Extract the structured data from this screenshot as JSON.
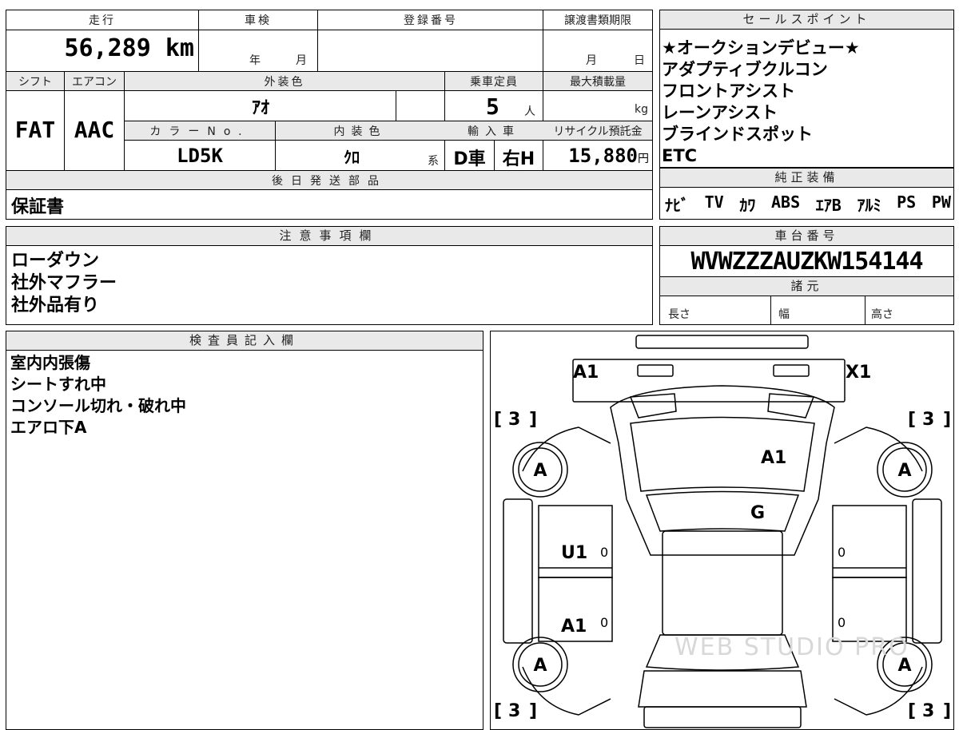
{
  "spec": {
    "mileage_label": "走行",
    "mileage_value": "56,289",
    "mileage_unit": "km",
    "shaken_label": "車検",
    "shaken_year": "年",
    "shaken_month": "月",
    "registration_label": "登録番号",
    "transfer_label": "譲渡書類期限",
    "transfer_month": "月",
    "transfer_day": "日",
    "shift_label": "シフト",
    "aircon_label": "エアコン",
    "exterior_label": "外装色",
    "capacity_label": "乗車定員",
    "load_label": "最大積載量",
    "shift_value": "FAT",
    "aircon_value": "AAC",
    "exterior_value": "ｱｵ",
    "capacity_value": "5",
    "capacity_unit": "人",
    "load_unit": "kg",
    "color_no_label": "カラーNo.",
    "interior_label": "内装色",
    "import_label": "輸入車",
    "recycle_label": "リサイクル預託金",
    "color_no_value": "LD5K",
    "interior_value": "ｸﾛ",
    "interior_suffix": "系",
    "import_value": "D車",
    "handle_value": "右H",
    "recycle_value": "15,880",
    "recycle_unit": "円",
    "later_parts_label": "後日発送部品",
    "later_parts_value": "保証書"
  },
  "sales_points": {
    "title": "セールスポイント",
    "items": [
      "★オークションデビュー★",
      "アダプティブクルコン",
      "フロントアシスト",
      "レーンアシスト",
      "ブラインドスポット",
      "ETC"
    ]
  },
  "genuine": {
    "title": "純正装備",
    "items": [
      "ﾅﾋﾞ",
      "TV",
      "ｶﾜ",
      "ABS",
      "ｴｱB",
      "ｱﾙﾐ",
      "PS",
      "PW"
    ]
  },
  "notes": {
    "title": "注意事項欄",
    "lines": [
      "ローダウン",
      "社外マフラー",
      "社外品有り"
    ]
  },
  "chassis": {
    "title": "車台番号",
    "value": "WVWZZZAUZKW154144",
    "spec_title": "諸元",
    "length": "長さ",
    "width": "幅",
    "height": "高さ"
  },
  "inspector": {
    "title": "検査員記入欄",
    "lines": [
      "室内内張傷",
      "シートすれ中",
      "コンソール切れ・破れ中",
      "エアロ下A"
    ]
  },
  "diagram": {
    "marks": [
      "A1",
      "X1",
      "A1",
      "G",
      "U1",
      "A1"
    ],
    "tires": [
      "A",
      "A",
      "A",
      "A"
    ],
    "tread": [
      "3",
      "3",
      "3",
      "3"
    ],
    "zeros": [
      "0",
      "0",
      "0",
      "0"
    ],
    "watermark": "WEB STUDIO PRO"
  }
}
